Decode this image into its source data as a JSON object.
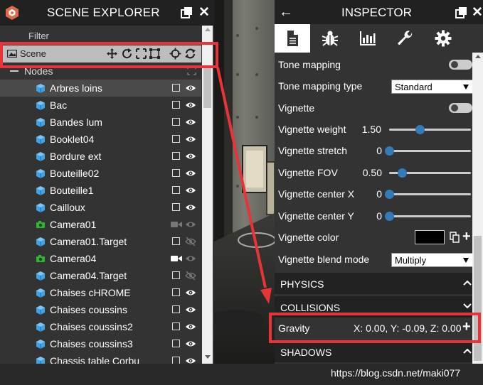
{
  "scene_explorer": {
    "title": "SCENE EXPLORER",
    "filter_label": "Filter",
    "scene_label": "Scene",
    "nodes_label": "Nodes",
    "nodes": [
      {
        "label": "Arbres loins",
        "type": "mesh",
        "selected": true
      },
      {
        "label": "Bac",
        "type": "mesh"
      },
      {
        "label": "Bandes lum",
        "type": "mesh"
      },
      {
        "label": "Booklet04",
        "type": "mesh"
      },
      {
        "label": "Bordure ext",
        "type": "mesh"
      },
      {
        "label": "Bouteille02",
        "type": "mesh"
      },
      {
        "label": "Bouteille1",
        "type": "mesh"
      },
      {
        "label": "Cailloux",
        "type": "mesh"
      },
      {
        "label": "Camera01",
        "type": "camera",
        "active": false
      },
      {
        "label": "Camera01.Target",
        "type": "mesh",
        "visible": false
      },
      {
        "label": "Camera04",
        "type": "camera",
        "active": true
      },
      {
        "label": "Camera04.Target",
        "type": "mesh",
        "visible": false
      },
      {
        "label": "Chaises cHROME",
        "type": "mesh"
      },
      {
        "label": "Chaises coussins",
        "type": "mesh"
      },
      {
        "label": "Chaises coussins2",
        "type": "mesh"
      },
      {
        "label": "Chaises coussins3",
        "type": "mesh"
      },
      {
        "label": "Chassis table Corbu",
        "type": "mesh"
      }
    ]
  },
  "inspector": {
    "title": "INSPECTOR",
    "tabs": [
      "properties-tab",
      "debug-tab",
      "statistics-tab",
      "tools-tab",
      "settings-tab"
    ],
    "tone_mapping": {
      "label": "Tone mapping",
      "enabled": false
    },
    "tone_mapping_type": {
      "label": "Tone mapping type",
      "value": "Standard"
    },
    "vignette": {
      "label": "Vignette",
      "enabled": false
    },
    "vignette_weight": {
      "label": "Vignette weight",
      "value": "1.50",
      "fraction": 0.37
    },
    "vignette_stretch": {
      "label": "Vignette stretch",
      "value": "0",
      "fraction": 0.0
    },
    "vignette_fov": {
      "label": "Vignette FOV",
      "value": "0.50",
      "fraction": 0.16
    },
    "vignette_center_x": {
      "label": "Vignette center X",
      "value": "0",
      "fraction": 0.0
    },
    "vignette_center_y": {
      "label": "Vignette center Y",
      "value": "0",
      "fraction": 0.0
    },
    "vignette_color": {
      "label": "Vignette color",
      "value": "#000000"
    },
    "vignette_blend_mode": {
      "label": "Vignette blend mode",
      "value": "Multiply"
    },
    "sections": {
      "physics": "PHYSICS",
      "collisions": "COLLISIONS",
      "shadows": "SHADOWS"
    },
    "gravity": {
      "label": "Gravity",
      "value": "X: 0.00, Y: -0.09, Z: 0.00"
    }
  },
  "watermark": "https://blog.csdn.net/maki077",
  "colors": {
    "accent": "#337ab7",
    "highlight": "#e83438",
    "mesh_icon": "#3ea1e4",
    "camera_icon": "#2eb82e"
  }
}
